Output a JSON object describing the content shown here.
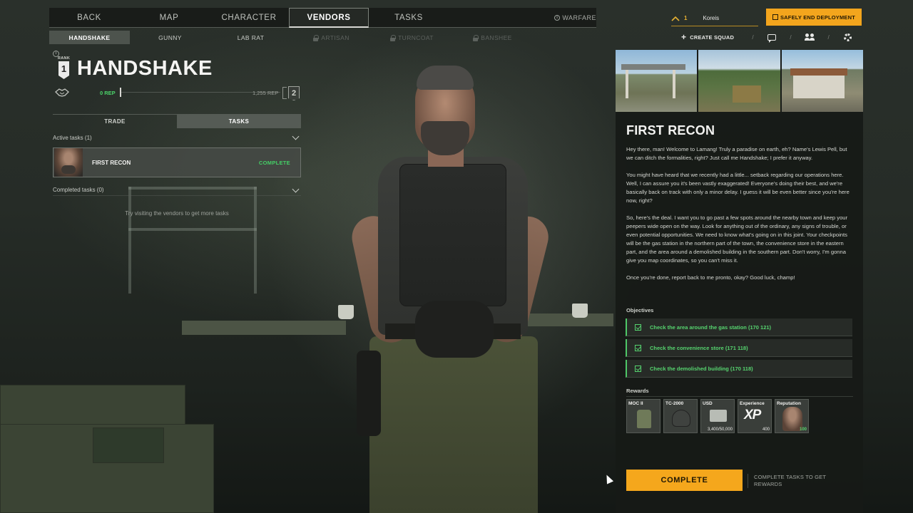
{
  "topnav": {
    "items": [
      {
        "label": "BACK"
      },
      {
        "label": "MAP"
      },
      {
        "label": "CHARACTER"
      },
      {
        "label": "VENDORS"
      },
      {
        "label": "TASKS"
      }
    ],
    "active": "VENDORS",
    "mode_label": "WARFARE"
  },
  "vendors": [
    {
      "label": "HANDSHAKE",
      "state": "active"
    },
    {
      "label": "GUNNY",
      "state": "open"
    },
    {
      "label": "LAB RAT",
      "state": "open"
    },
    {
      "label": "ARTISAN",
      "state": "locked"
    },
    {
      "label": "TURNCOAT",
      "state": "locked"
    },
    {
      "label": "BANSHEE",
      "state": "locked"
    }
  ],
  "vendor": {
    "rank_label": "RANK",
    "rank": "1",
    "name": "HANDSHAKE",
    "rep_current": "0 REP",
    "rep_next": "1,255 REP",
    "next_rank": "2",
    "rep_progress": 0.0
  },
  "trade_tabs": {
    "trade": "TRADE",
    "tasks": "TASKS",
    "active": "TASKS"
  },
  "active_tasks": {
    "header": "Active tasks (1)",
    "items": [
      {
        "name": "FIRST RECON",
        "status": "COMPLETE"
      }
    ]
  },
  "completed_tasks": {
    "header": "Completed tasks (0)",
    "empty_note": "Try visiting the vendors to get more tasks"
  },
  "squad": {
    "level": "1",
    "player_name": "Koreis",
    "deploy_label": "SAFELY END DEPLOYMENT",
    "create_squad_label": "CREATE SQUAD"
  },
  "task_detail": {
    "title": "FIRST RECON",
    "description": [
      "Hey there, man! Welcome to Lamang! Truly a paradise on earth, eh? Name's Lewis Pell, but we can ditch the formalities, right? Just call me Handshake; I prefer it anyway.",
      "You might have heard that we recently had a little... setback regarding our operations here. Well, I can assure you it's been vastly exaggerated! Everyone's doing their best, and we're basically back on track with only a minor delay. I guess it will be even better since you're here now, right?",
      "So, here's the deal. I want you to go past a few spots around the nearby town and keep your peepers wide open on the way. Look for anything out of the ordinary, any signs of trouble, or even potential opportunities. We need to know what's going on in this joint. Your checkpoints will be the gas station in the northern part of the town, the convenience store in the eastern part, and the area around a demolished building in the southern part. Don't worry, I'm gonna give you map coordinates, so you can't miss it.",
      "Once you're done, report back to me pronto, okay? Good luck, champ!"
    ],
    "objectives_header": "Objectives",
    "objectives": [
      "Check the area around the gas station (170 121)",
      "Check the convenience store (171 118)",
      "Check the demolished building (170 118)"
    ],
    "rewards_header": "Rewards",
    "rewards": [
      {
        "name": "MOC II",
        "value": ""
      },
      {
        "name": "TC-2000",
        "value": ""
      },
      {
        "name": "USD",
        "value": "3,400/50,000"
      },
      {
        "name": "Experience",
        "value": "400"
      },
      {
        "name": "Reputation",
        "value": "100"
      }
    ],
    "complete_label": "COMPLETE",
    "complete_note": "COMPLETE TASKS TO GET REWARDS"
  }
}
